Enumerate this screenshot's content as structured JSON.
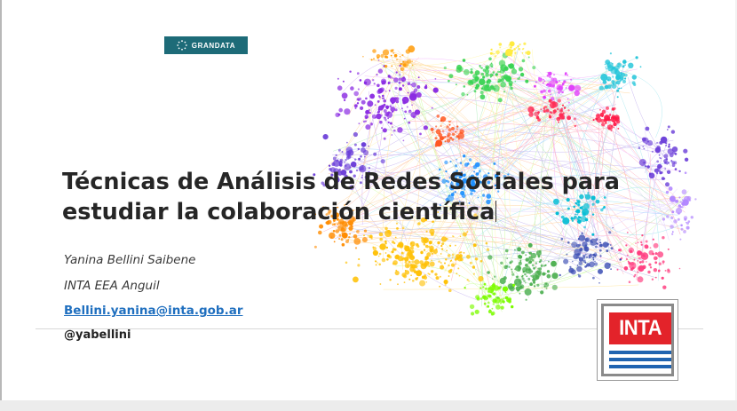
{
  "slide": {
    "logo_top": "GRANDATA",
    "title_line1": "Técnicas de Análisis de Redes Sociales para",
    "title_line2": "estudiar la colaboración científica",
    "author": "Yanina Bellini Saibene",
    "affiliation": "INTA EEA Anguil",
    "email": "Bellini.yanina@inta.gob.ar",
    "handle": "@yabellini",
    "logo_bottom": "INTA"
  },
  "colors": {
    "grandata_bg": "#1d6b78",
    "inta_red": "#e3232a",
    "inta_blue": "#1f63b0",
    "link": "#1f6fbf"
  },
  "icons": {
    "grandata_mark": "dotted-ring-icon",
    "network": "network-graph-image"
  }
}
